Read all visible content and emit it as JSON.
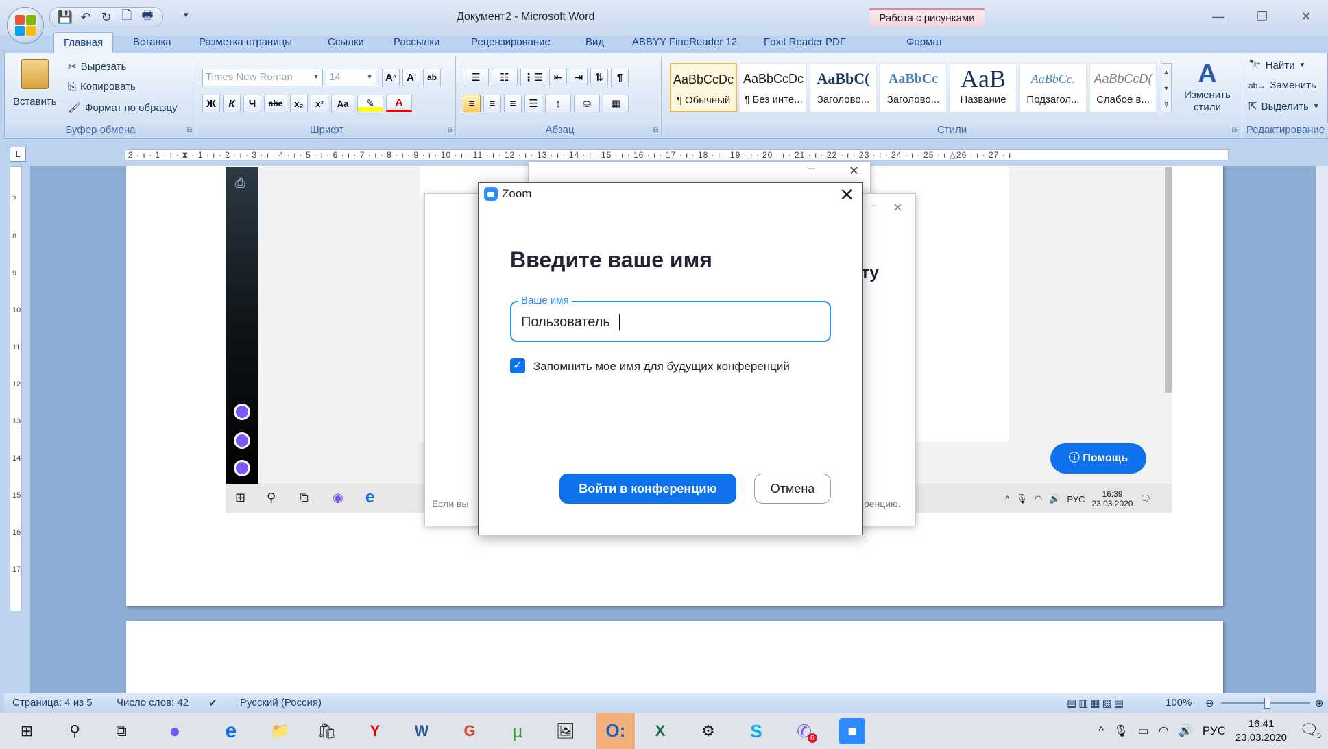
{
  "window": {
    "title": "Документ2 - Microsoft Word",
    "context_tab_header": "Работа с рисунками"
  },
  "ribbon_tabs": [
    "Главная",
    "Вставка",
    "Разметка страницы",
    "Ссылки",
    "Рассылки",
    "Рецензирование",
    "Вид",
    "ABBYY FineReader 12",
    "Foxit Reader PDF",
    "Формат"
  ],
  "clipboard": {
    "paste": "Вставить",
    "cut": "Вырезать",
    "copy": "Копировать",
    "format_painter": "Формат по образцу",
    "label": "Буфер обмена"
  },
  "font": {
    "name": "Times New Roman",
    "size": "14",
    "label": "Шрифт",
    "bold": "Ж",
    "italic": "К",
    "underline": "Ч",
    "strike": "abe",
    "sub": "x₂",
    "sup": "x²",
    "case": "Aa"
  },
  "paragraph": {
    "label": "Абзац"
  },
  "styles": {
    "label": "Стили",
    "items": [
      {
        "sample": "AaBbCcDc",
        "name": "¶ Обычный"
      },
      {
        "sample": "AaBbCcDc",
        "name": "¶ Без инте..."
      },
      {
        "sample": "AaBbC(",
        "name": "Заголово..."
      },
      {
        "sample": "AaBbCc",
        "name": "Заголово..."
      },
      {
        "sample": "AaB",
        "name": "Название"
      },
      {
        "sample": "AaBbCc.",
        "name": "Подзагол..."
      },
      {
        "sample": "AaBbCcD(",
        "name": "Слабое в..."
      }
    ],
    "change_styles": "Изменить стили"
  },
  "editing": {
    "label": "Редактирование",
    "find": "Найти",
    "replace": "Заменить",
    "select": "Выделить"
  },
  "ruler_text": "2 · ı · 1 · ı · ⧗ · 1 · ı · 2 · ı · 3 · ı · 4 · ı · 5 · ı · 6 · ı · 7 · ı · 8 · ı · 9 · ı · 10 · ı · 11 · ı · 12 · ı · 13 · ı · 14 · ı · 15 · ı · 16 · ı · 17 · ı · 18 · ı · 19 · ı · 20 · ı · 21 · ı · 22 · ı · 23 · ı · 24 · ı · 25 · ı △26 · ı · 27 · ı",
  "vruler": [
    "7",
    "8",
    "9",
    "10",
    "11",
    "12",
    "13",
    "14",
    "15",
    "16",
    "17"
  ],
  "picture": {
    "help_button": "Помощь",
    "back_text_left": "Если вы",
    "back_text_right": "ренцию.",
    "back_heading_fragment": "ту",
    "taskbar_lang": "РУС",
    "taskbar_time": "16:39",
    "taskbar_date": "23.03.2020"
  },
  "zoom_dialog": {
    "app_name": "Zoom",
    "heading": "Введите ваше имя",
    "field_label": "Ваше имя",
    "field_value": "Пользователь",
    "remember_label": "Запомнить мое имя для будущих конференций",
    "remember_checked": true,
    "join_button": "Войти в конференцию",
    "cancel_button": "Отмена",
    "accent_color": "#0e72ed"
  },
  "statusbar": {
    "page": "Страница: 4 из 5",
    "words": "Число слов: 42",
    "language": "Русский (Россия)",
    "zoom": "100%"
  },
  "taskbar": {
    "language": "РУС",
    "time": "16:41",
    "date": "23.03.2020",
    "viber_badge": "6",
    "notification_count": "5"
  }
}
